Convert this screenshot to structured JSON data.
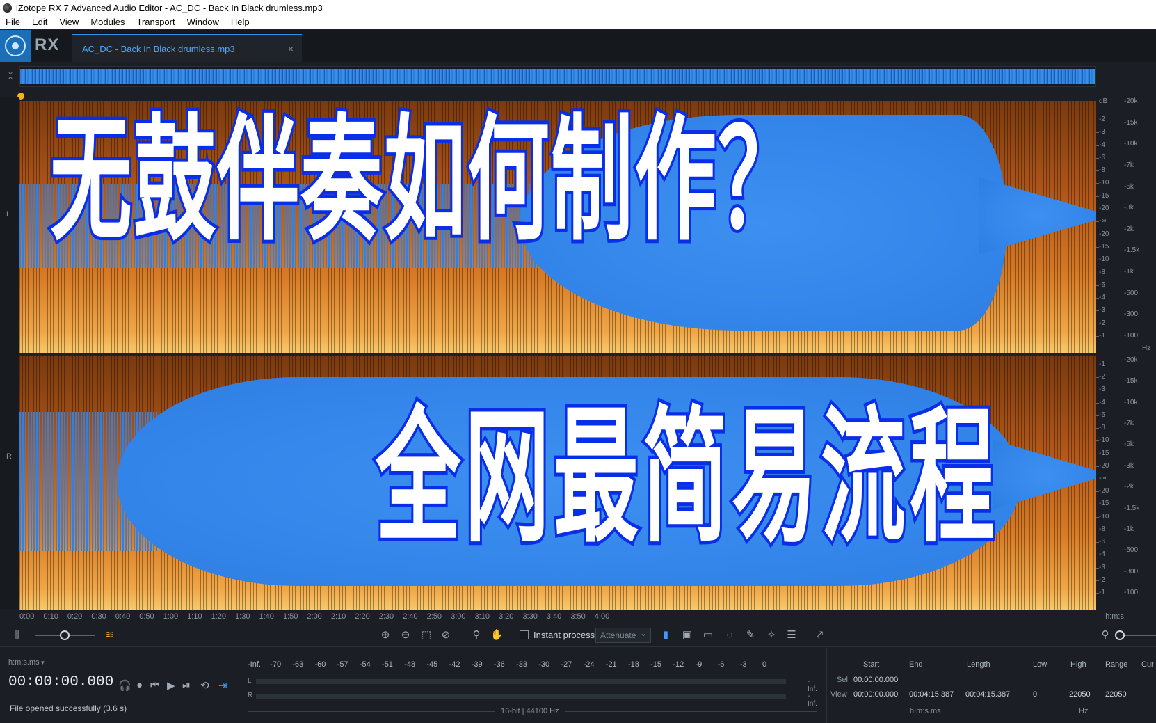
{
  "window": {
    "title": "iZotope RX 7 Advanced Audio Editor - AC_DC - Back In Black drumless.mp3"
  },
  "menu": [
    "File",
    "Edit",
    "View",
    "Modules",
    "Transport",
    "Window",
    "Help"
  ],
  "header": {
    "rx_label": "RX",
    "file_tab": "AC_DC - Back In Black drumless.mp3",
    "close_glyph": "×"
  },
  "channels": {
    "left": "L",
    "right": "R"
  },
  "scale": {
    "db_unit": "dB",
    "hz_unit": "Hz",
    "left": {
      "db": [
        "-2",
        "-3",
        "-4",
        "-6",
        "-8",
        "-10",
        "-15",
        "-20",
        "-∞",
        "-20",
        "-15",
        "-10",
        "-8",
        "-6",
        "-4",
        "-3",
        "-2",
        "-1"
      ],
      "hz": [
        "-20k",
        "-15k",
        "-10k",
        "-7k",
        "-5k",
        "-3k",
        "-2k",
        "-1.5k",
        "-1k",
        "-500",
        "-300",
        "-100"
      ]
    },
    "right": {
      "db": [
        "-1",
        "-2",
        "-3",
        "-4",
        "-6",
        "-8",
        "-10",
        "-15",
        "-20",
        "-∞",
        "-20",
        "-15",
        "-10",
        "-8",
        "-6",
        "-4",
        "-3",
        "-2",
        "-1"
      ],
      "hz": [
        "-20k",
        "-15k",
        "-10k",
        "-7k",
        "-5k",
        "-3k",
        "-2k",
        "-1.5k",
        "-1k",
        "-500",
        "-300",
        "-100"
      ]
    }
  },
  "ruler": {
    "ticks": [
      "0:00",
      "0:10",
      "0:20",
      "0:30",
      "0:40",
      "0:50",
      "1:00",
      "1:10",
      "1:20",
      "1:30",
      "1:40",
      "1:50",
      "2:00",
      "2:10",
      "2:20",
      "2:30",
      "2:40",
      "2:50",
      "3:00",
      "3:10",
      "3:20",
      "3:30",
      "3:40",
      "3:50",
      "4:00"
    ],
    "unit": "h:m:s"
  },
  "toolbar": {
    "instant_process": "Instant process",
    "attenuate": "Attenuate"
  },
  "bottom": {
    "time_format": "h:m:s.ms",
    "time": "00:00:00.000",
    "status": "File opened successfully (3.6 s)",
    "meter_scale": [
      "-Inf.",
      "-70",
      "-63",
      "-60",
      "-57",
      "-54",
      "-51",
      "-48",
      "-45",
      "-42",
      "-39",
      "-36",
      "-33",
      "-30",
      "-27",
      "-24",
      "-21",
      "-18",
      "-15",
      "-12",
      "-9",
      "-6",
      "-3",
      "0"
    ],
    "meter_L": "L",
    "meter_R": "R",
    "inf_L": "-Inf.",
    "inf_R": "-Inf.",
    "bitrate": "16-bit | 44100 Hz"
  },
  "selection": {
    "headers": [
      "Start",
      "End",
      "Length",
      "Low",
      "High",
      "Range",
      "Cur"
    ],
    "sel_label": "Sel",
    "view_label": "View",
    "sel_start": "00:00:00.000",
    "view_start": "00:00:00.000",
    "view_end": "00:04:15.387",
    "view_length": "00:04:15.387",
    "low": "0",
    "high": "22050",
    "range": "22050",
    "hms": "h:m:s.ms",
    "hz": "Hz"
  },
  "overlay": {
    "line1": "无鼓伴奏如何制作？",
    "line2": "全网最简易流程"
  },
  "colors": {
    "accent": "#2a8fe8",
    "spectrogram_blue": "#3486ea",
    "spectrogram_orange": "#d77b26",
    "overlay_outline": "#0a2fe8"
  }
}
